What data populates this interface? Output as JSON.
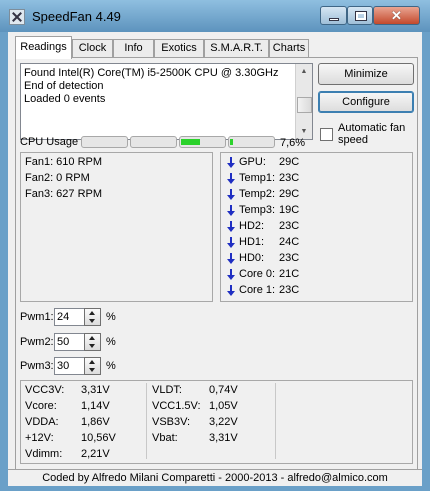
{
  "window": {
    "title": "SpeedFan 4.49"
  },
  "tabs": [
    "Readings",
    "Clock",
    "Info",
    "Exotics",
    "S.M.A.R.T.",
    "Charts"
  ],
  "log": {
    "lines": [
      "Found Intel(R) Core(TM) i5-2500K CPU @ 3.30GHz",
      "End of detection",
      "Loaded 0 events"
    ]
  },
  "buttons": {
    "minimize": "Minimize",
    "configure": "Configure"
  },
  "auto_fan": {
    "label": "Automatic fan speed",
    "checked": false
  },
  "cpu": {
    "label": "CPU Usage",
    "usage_percent": "7,6%",
    "cores": [
      0,
      0,
      0.45,
      0.07
    ]
  },
  "fans": [
    {
      "text": "Fan1: 610 RPM"
    },
    {
      "text": "Fan2: 0 RPM"
    },
    {
      "text": "Fan3: 627 RPM"
    }
  ],
  "temps": [
    {
      "name": "GPU:",
      "value": "29C",
      "trend_icon": "arrow-down-icon"
    },
    {
      "name": "Temp1:",
      "value": "23C",
      "trend_icon": "arrow-down-icon"
    },
    {
      "name": "Temp2:",
      "value": "29C",
      "trend_icon": "arrow-down-icon"
    },
    {
      "name": "Temp3:",
      "value": "19C",
      "trend_icon": "arrow-down-icon"
    },
    {
      "name": "HD2:",
      "value": "23C",
      "trend_icon": "arrow-down-icon"
    },
    {
      "name": "HD1:",
      "value": "24C",
      "trend_icon": "arrow-down-icon"
    },
    {
      "name": "HD0:",
      "value": "23C",
      "trend_icon": "arrow-down-icon"
    },
    {
      "name": "Core 0:",
      "value": "21C",
      "trend_icon": "arrow-down-icon"
    },
    {
      "name": "Core 1:",
      "value": "23C",
      "trend_icon": "arrow-down-icon"
    }
  ],
  "pwm": [
    {
      "label": "Pwm1:",
      "value": "24",
      "unit": "%"
    },
    {
      "label": "Pwm2:",
      "value": "50",
      "unit": "%"
    },
    {
      "label": "Pwm3:",
      "value": "30",
      "unit": "%"
    }
  ],
  "voltages_left": [
    {
      "label": "VCC3V:",
      "value": "3,31V"
    },
    {
      "label": "Vcore:",
      "value": "1,14V"
    },
    {
      "label": "VDDA:",
      "value": "1,86V"
    },
    {
      "label": "+12V:",
      "value": "10,56V"
    },
    {
      "label": "Vdimm:",
      "value": "2,21V"
    }
  ],
  "voltages_right": [
    {
      "label": "VLDT:",
      "value": "0,74V"
    },
    {
      "label": "VCC1.5V:",
      "value": "1,05V"
    },
    {
      "label": "VSB3V:",
      "value": "3,22V"
    },
    {
      "label": "Vbat:",
      "value": "3,31V"
    }
  ],
  "status_bar": {
    "text": "Coded by Alfredo Milani Comparetti - 2000-2013 - alfredo@almico.com"
  },
  "colors": {
    "accent_green": "#2bd22b",
    "arrow_blue": "#1f2ec2",
    "close_red": "#c3492c"
  }
}
